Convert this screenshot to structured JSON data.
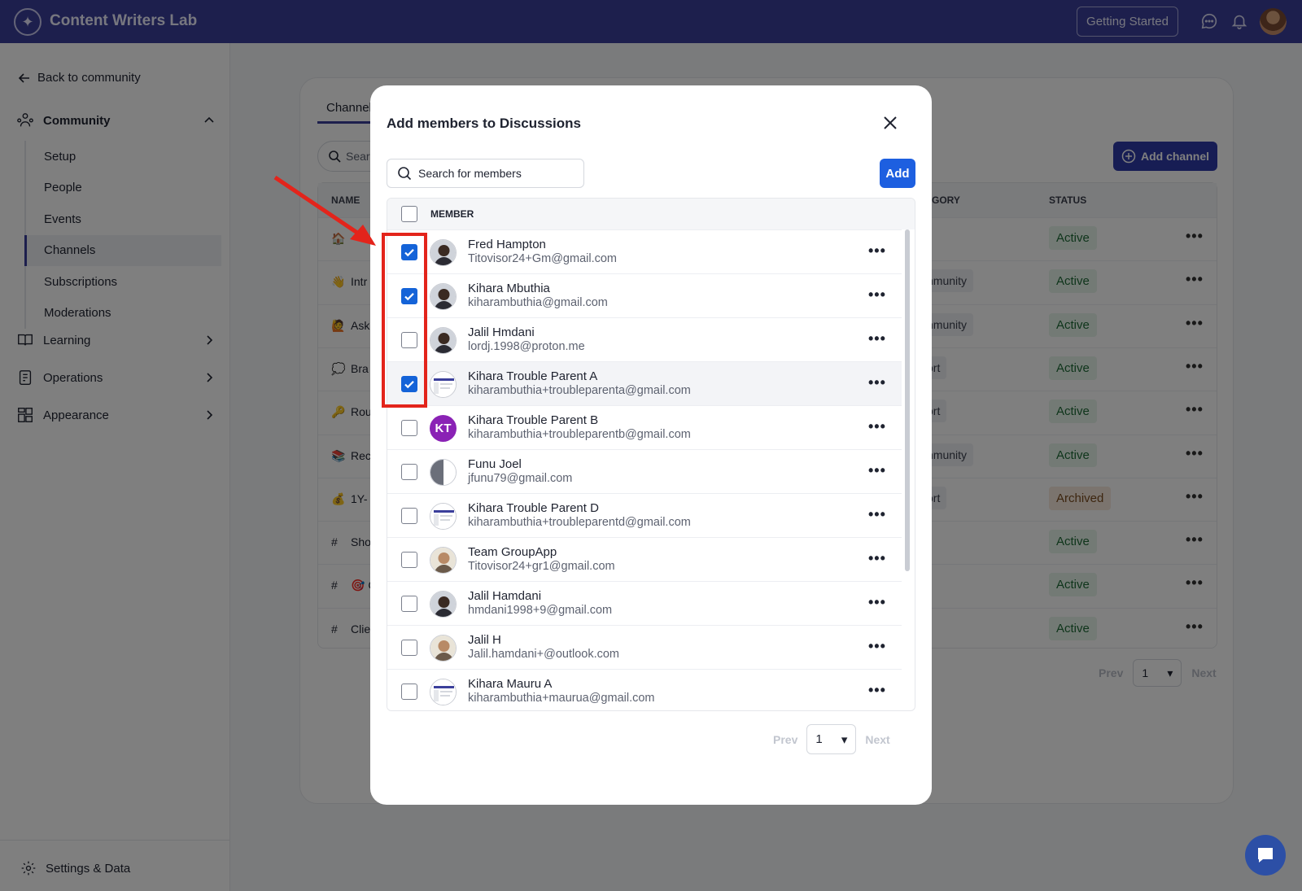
{
  "app": {
    "name": "Content Writers Lab",
    "getting_started": "Getting Started"
  },
  "sidebar": {
    "back": "Back to community",
    "community": "Community",
    "community_items": [
      "Setup",
      "People",
      "Events",
      "Channels",
      "Subscriptions",
      "Moderations"
    ],
    "active_item": "Channels",
    "learning": "Learning",
    "operations": "Operations",
    "appearance": "Appearance",
    "settings": "Settings & Data"
  },
  "page": {
    "tab": "Channel",
    "search_placeholder": "Sear",
    "add_channel": "Add channel",
    "columns": {
      "name": "NAME",
      "category": "GORY",
      "status": "STATUS"
    },
    "rows": [
      {
        "icon": "🏠",
        "name": "",
        "category": "",
        "status": "Active"
      },
      {
        "icon": "👋",
        "name": "Intr",
        "category": "nmunity",
        "status": "Active"
      },
      {
        "icon": "🙋",
        "name": "Ask",
        "category": "nmunity",
        "status": "Active"
      },
      {
        "icon": "💭",
        "name": "Bra",
        "category": "ort",
        "status": "Active"
      },
      {
        "icon": "🔑",
        "name": "Rou",
        "category": "ort",
        "status": "Active"
      },
      {
        "icon": "📚",
        "name": "Rec",
        "category": "nmunity",
        "status": "Active"
      },
      {
        "icon": "💰",
        "name": "1Y-",
        "category": "ort",
        "status": "Archived"
      },
      {
        "icon": "#",
        "name": "Sho",
        "category": "",
        "status": "Active"
      },
      {
        "icon": "#",
        "name": "🎯 C",
        "category": "",
        "status": "Active"
      },
      {
        "icon": "#",
        "name": "Clie",
        "category": "",
        "status": "Active"
      }
    ],
    "pager": {
      "prev": "Prev",
      "page": "1",
      "next": "Next"
    }
  },
  "modal": {
    "title": "Add members to Discussions",
    "search_placeholder": "Search for members",
    "add": "Add",
    "column_member": "MEMBER",
    "members": [
      {
        "name": "Fred Hampton",
        "email": "Titovisor24+Gm@gmail.com",
        "checked": true,
        "avatar": "photo-dark"
      },
      {
        "name": "Kihara Mbuthia",
        "email": "kiharambuthia@gmail.com",
        "checked": true,
        "avatar": "photo-dark"
      },
      {
        "name": "Jalil Hmdani",
        "email": "lordj.1998@proton.me",
        "checked": false,
        "avatar": "photo-dark"
      },
      {
        "name": "Kihara Trouble Parent A",
        "email": "kiharambuthia+troubleparenta@gmail.com",
        "checked": true,
        "avatar": "screenshot"
      },
      {
        "name": "Kihara Trouble Parent B",
        "email": "kiharambuthia+troubleparentb@gmail.com",
        "checked": false,
        "avatar": "KT"
      },
      {
        "name": "Funu Joel",
        "email": "jfunu79@gmail.com",
        "checked": false,
        "avatar": "half"
      },
      {
        "name": "Kihara Trouble Parent D",
        "email": "kiharambuthia+troubleparentd@gmail.com",
        "checked": false,
        "avatar": "screenshot"
      },
      {
        "name": "Team GroupApp",
        "email": "Titovisor24+gr1@gmail.com",
        "checked": false,
        "avatar": "photo-light"
      },
      {
        "name": "Jalil Hamdani",
        "email": "hmdani1998+9@gmail.com",
        "checked": false,
        "avatar": "photo-dark"
      },
      {
        "name": "Jalil H",
        "email": "Jalil.hamdani+@outlook.com",
        "checked": false,
        "avatar": "photo-light"
      },
      {
        "name": "Kihara Mauru A",
        "email": "kiharambuthia+maurua@gmail.com",
        "checked": false,
        "avatar": "screenshot"
      }
    ],
    "pager": {
      "prev": "Prev",
      "page": "1",
      "next": "Next"
    }
  },
  "colors": {
    "topbar": "#3b3f9b",
    "primary_button": "#1d5fe0",
    "checkbox_checked": "#1463d8",
    "annotation": "#e3241b"
  }
}
